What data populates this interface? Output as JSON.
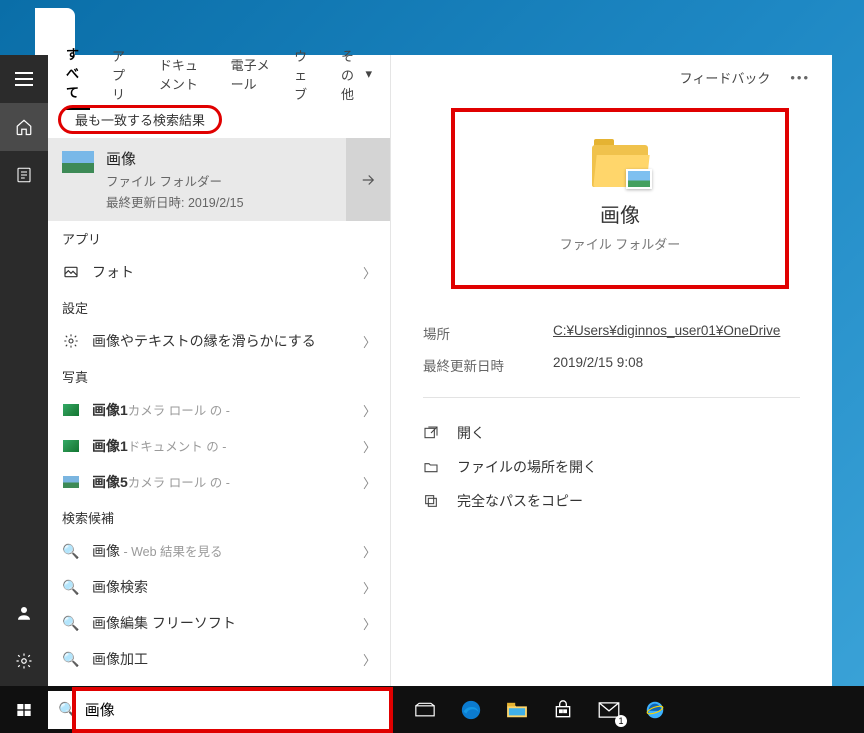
{
  "tabs": {
    "all": "すべて",
    "apps": "アプリ",
    "docs": "ドキュメント",
    "email": "電子メール",
    "web": "ウェブ",
    "other": "その他"
  },
  "right_top": {
    "feedback": "フィードバック"
  },
  "best_match_label": "最も一致する検索結果",
  "best": {
    "title": "画像",
    "type": "ファイル フォルダー",
    "updated": "最終更新日時: 2019/2/15"
  },
  "groups": {
    "apps": "アプリ",
    "settings": "設定",
    "photos_section": "写真",
    "suggestions": "検索候補"
  },
  "rows": {
    "photos_app": "フォト",
    "smooth_edges": "画像やテキストの縁を滑らかにする",
    "photo1_camera_pre": "画像1",
    "photo1_camera_suf": "カメラ ロール の -",
    "photo1_doc_pre": "画像1",
    "photo1_doc_suf": "ドキュメント の -",
    "photo5_camera_pre": "画像5",
    "photo5_camera_suf": "カメラ ロール の -",
    "sugg_web_pre": "画像",
    "sugg_web_suf": " - Web 結果を見る",
    "sugg_search": "画像検索",
    "sugg_edit": "画像編集 フリーソフト",
    "sugg_process": "画像加工"
  },
  "preview": {
    "title": "画像",
    "type": "ファイル フォルダー"
  },
  "meta": {
    "location_label": "場所",
    "location_value": "C:¥Users¥diginnos_user01¥OneDrive",
    "updated_label": "最終更新日時",
    "updated_value": "2019/2/15 9:08"
  },
  "actions": {
    "open": "開く",
    "open_location": "ファイルの場所を開く",
    "copy_path": "完全なパスをコピー"
  },
  "search": {
    "value": "画像"
  }
}
